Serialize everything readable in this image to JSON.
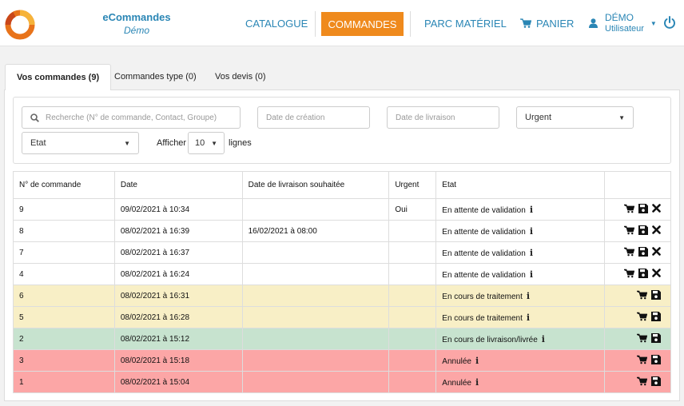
{
  "brand": {
    "name": "eCommandes",
    "sub": "Démo"
  },
  "nav": {
    "catalogue": "CATALOGUE",
    "commandes": "COMMANDES",
    "parc": "PARC MATÉRIEL",
    "panier": "PANIER"
  },
  "user": {
    "name": "DÉMO",
    "role": "Utilisateur"
  },
  "tabs": [
    {
      "label": "Vos commandes (9)"
    },
    {
      "label": "Commandes type (0)"
    },
    {
      "label": "Vos devis (0)"
    }
  ],
  "filters": {
    "search_placeholder": "Recherche (N° de commande, Contact, Groupe)",
    "date_creation_placeholder": "Date de création",
    "date_livraison_placeholder": "Date de livraison",
    "urgent_value": "Urgent",
    "etat_value": "Etat",
    "afficher_label": "Afficher",
    "page_size": "10",
    "lignes_label": "lignes"
  },
  "table": {
    "headers": [
      "N° de commande",
      "Date",
      "Date de livraison souhaitée",
      "Urgent",
      "Etat"
    ],
    "rows": [
      {
        "num": "9",
        "date": "09/02/2021 à 10:34",
        "livraison": "",
        "urgent": "Oui",
        "etat": "En attente de validation"
      },
      {
        "num": "8",
        "date": "08/02/2021 à 16:39",
        "livraison": "16/02/2021 à 08:00",
        "urgent": "",
        "etat": "En attente de validation"
      },
      {
        "num": "7",
        "date": "08/02/2021 à 16:37",
        "livraison": "",
        "urgent": "",
        "etat": "En attente de validation"
      },
      {
        "num": "4",
        "date": "08/02/2021 à 16:24",
        "livraison": "",
        "urgent": "",
        "etat": "En attente de validation"
      },
      {
        "num": "6",
        "date": "08/02/2021 à 16:31",
        "livraison": "",
        "urgent": "",
        "etat": "En cours de traitement"
      },
      {
        "num": "5",
        "date": "08/02/2021 à 16:28",
        "livraison": "",
        "urgent": "",
        "etat": "En cours de traitement"
      },
      {
        "num": "2",
        "date": "08/02/2021 à 15:12",
        "livraison": "",
        "urgent": "",
        "etat": "En cours de livraison/livrée"
      },
      {
        "num": "3",
        "date": "08/02/2021 à 15:18",
        "livraison": "",
        "urgent": "",
        "etat": "Annulée"
      },
      {
        "num": "1",
        "date": "08/02/2021 à 15:04",
        "livraison": "",
        "urgent": "",
        "etat": "Annulée"
      }
    ]
  },
  "colors": {
    "accent": "#ef8a1d",
    "link": "#2a86b5",
    "pending": "#ffffff",
    "processing": "#f8efc6",
    "shipping": "#c7e3cf",
    "cancelled": "#fca6a6"
  },
  "icons": [
    "logo-icon",
    "cart-icon",
    "user-icon",
    "power-icon",
    "search-icon",
    "info-icon",
    "reorder-cart-icon",
    "save-icon",
    "cancel-icon"
  ]
}
